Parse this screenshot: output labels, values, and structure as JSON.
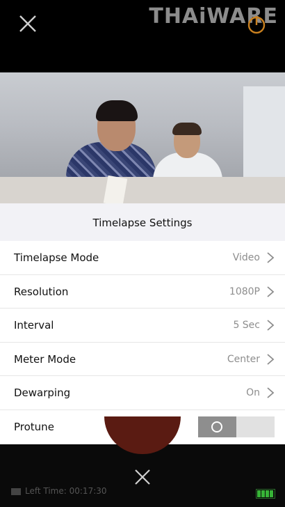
{
  "watermark": "THAiWARE",
  "sheet": {
    "title": "Timelapse Settings",
    "rows": [
      {
        "label": "Timelapse Mode",
        "value": "Video"
      },
      {
        "label": "Resolution",
        "value": "1080P"
      },
      {
        "label": "Interval",
        "value": "5 Sec"
      },
      {
        "label": "Meter Mode",
        "value": "Center"
      },
      {
        "label": "Dewarping",
        "value": "On"
      },
      {
        "label": "Protune",
        "toggle_on": false
      }
    ]
  },
  "status": {
    "left_time_label": "Left Time: 00:17:30",
    "battery_level": 1.0
  },
  "colors": {
    "sheet_title_bg": "#f2f2f6",
    "value_gray": "#8d8d8d",
    "toggle_knob": "#8e8e8e"
  },
  "icons": [
    "close-icon",
    "power-icon",
    "chevron-right-icon",
    "camera-icon",
    "battery-icon"
  ]
}
